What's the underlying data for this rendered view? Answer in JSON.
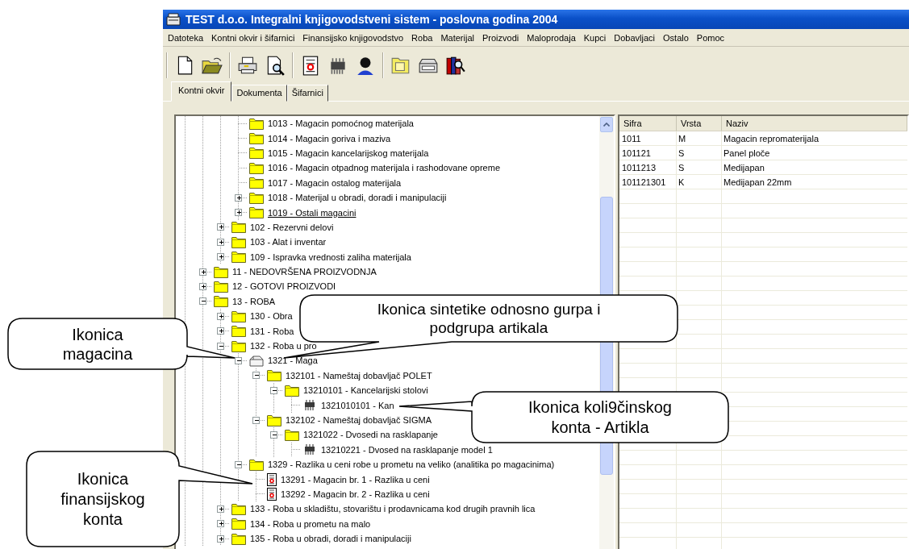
{
  "window": {
    "title": "TEST d.o.o. Integralni knjigovodstveni sistem - poslovna godina 2004"
  },
  "menu": [
    "Datoteka",
    "Kontni okvir i šifarnici",
    "Finansijsko knjigovodstvo",
    "Roba",
    "Materijal",
    "Proizvodi",
    "Maloprodaja",
    "Kupci",
    "Dobavljaci",
    "Ostalo",
    "Pomoc"
  ],
  "tabs": [
    {
      "label": "Kontni okvir",
      "selected": true
    },
    {
      "label": "Dokumenta",
      "selected": false
    },
    {
      "label": "Šifarnici",
      "selected": false
    }
  ],
  "tree": {
    "items": [
      {
        "children": [
          {
            "children": [
              {
                "children": [
                  {
                    "label": "1013 - Magacin pomoćnog materijala",
                    "kind": "folder",
                    "hover": false
                  },
                  {
                    "label": "1014 - Magacin goriva i maziva",
                    "kind": "folder",
                    "hover": false
                  },
                  {
                    "label": "1015 - Magacin kancelarijskog materijala",
                    "kind": "folder",
                    "hover": false
                  },
                  {
                    "label": "1016 - Magacin otpadnog materijala i rashodovane opreme",
                    "kind": "folder",
                    "hover": false
                  },
                  {
                    "label": "1017 - Magacin ostalog materijala",
                    "kind": "folder",
                    "hover": false
                  },
                  {
                    "label": "1018 - Materijal u obradi, doradi i manipulaciji",
                    "kind": "folder",
                    "expanded": false,
                    "hover": false
                  },
                  {
                    "label": "1019 - Ostali magacini",
                    "kind": "folder",
                    "expanded": false,
                    "hover": true
                  }
                ]
              },
              {
                "label": "102 - Rezervni delovi",
                "kind": "folder",
                "expanded": false,
                "hover": false
              },
              {
                "label": "103 - Alat i inventar",
                "kind": "folder",
                "expanded": false,
                "hover": false
              },
              {
                "label": "109 - Ispravka vrednosti zaliha materijala",
                "kind": "folder",
                "expanded": false,
                "hover": false
              }
            ]
          },
          {
            "label": "11 - NEDOVRŠENA PROIZVODNJA",
            "kind": "folder",
            "expanded": false,
            "hover": false
          },
          {
            "label": "12 - GOTOVI PROIZVODI",
            "kind": "folder",
            "expanded": false,
            "hover": false
          },
          {
            "label": "13 - ROBA",
            "kind": "folder",
            "expanded": true,
            "hover": false,
            "children": [
              {
                "label": "130 - Obra",
                "kind": "folder",
                "expanded": false,
                "hover": false
              },
              {
                "label": "131 - Roba",
                "kind": "folder",
                "expanded": false,
                "hover": false
              },
              {
                "label": "132 - Roba u pro",
                "kind": "folder",
                "expanded": true,
                "hover": false,
                "children": [
                  {
                    "label": "1321 - Maga",
                    "kind": "warehouse",
                    "expanded": true,
                    "hover": false,
                    "children": [
                      {
                        "label": "132101 - Nameštaj dobavljač POLET",
                        "kind": "folder",
                        "expanded": true,
                        "hover": false,
                        "children": [
                          {
                            "label": "13210101 - Kancelarijski stolovi",
                            "kind": "folder",
                            "expanded": true,
                            "hover": false,
                            "children": [
                              {
                                "label": "1321010101 - Kan",
                                "kind": "article",
                                "hover": false
                              }
                            ]
                          }
                        ]
                      },
                      {
                        "label": "132102 - Nameštaj dobavljač SIGMA",
                        "kind": "folder",
                        "expanded": true,
                        "hover": false,
                        "children": [
                          {
                            "label": "1321022 - Dvosedi na rasklapanje",
                            "kind": "folder",
                            "expanded": true,
                            "hover": false,
                            "children": [
                              {
                                "label": "13210221 - Dvosed na rasklapanje model 1",
                                "kind": "article",
                                "hover": false
                              }
                            ]
                          }
                        ]
                      }
                    ]
                  },
                  {
                    "label": "1329 - Razlika u ceni robe u prometu na veliko (analitika po magacinima)",
                    "kind": "folder",
                    "expanded": true,
                    "hover": false,
                    "children": [
                      {
                        "label": "13291 - Magacin br. 1 - Razlika u ceni",
                        "kind": "account",
                        "hover": false
                      },
                      {
                        "label": "13292 - Magacin br. 2 - Razlika u ceni",
                        "kind": "account",
                        "hover": false
                      }
                    ]
                  }
                ]
              },
              {
                "label": "133 - Roba u skladištu, stovarištu i prodavnicama kod drugih pravnih lica",
                "kind": "folder",
                "expanded": false,
                "hover": false
              },
              {
                "label": "134 - Roba u prometu na malo",
                "kind": "folder",
                "expanded": false,
                "hover": false
              },
              {
                "label": "135 - Roba u obradi, doradi i manipulaciji",
                "kind": "folder",
                "expanded": false,
                "hover": false
              }
            ]
          }
        ]
      }
    ]
  },
  "list": {
    "columns": [
      "Sifra",
      "Vrsta",
      "Naziv"
    ],
    "rows": [
      [
        "1011",
        "M",
        "Magacin repromaterijala"
      ],
      [
        "101121",
        "S",
        "Panel ploče"
      ],
      [
        "1011213",
        "S",
        "Medijapan"
      ],
      [
        "101121301",
        "K",
        "Medijapan 22mm"
      ]
    ]
  },
  "callouts": [
    {
      "text": "Ikonica sintetike odnosno gurpa i\npodgrupa artikala"
    },
    {
      "text": "Ikonica\nmagacina"
    },
    {
      "text": "Ikonica koli9činskog\nkonta - Artikla"
    },
    {
      "text": "Ikonica\nfinansijskog\nkonta"
    }
  ]
}
